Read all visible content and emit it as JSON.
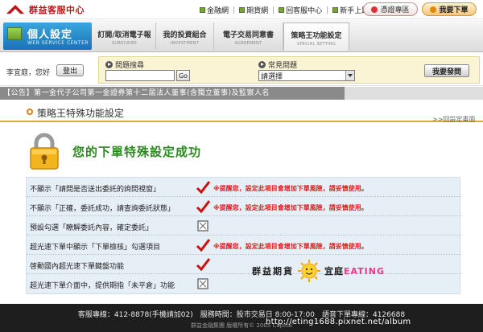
{
  "header": {
    "brand_name": "群益客服中心",
    "top_links": [
      "金融網",
      "期貨網",
      "回客服中心",
      "新手上路"
    ],
    "voice_zone": "憑證專區",
    "order_button": "我要下單"
  },
  "nav": {
    "personal_title": "個人設定",
    "personal_subtitle": "WEB SERVICE CENTER",
    "tabs": [
      {
        "label": "訂閱/取消電子報",
        "sub": "SUBSCRIBE"
      },
      {
        "label": "我的投資組合",
        "sub": "INVESTMENT"
      },
      {
        "label": "電子交易同意書",
        "sub": "AGREEMENT"
      },
      {
        "label": "策略王功能設定",
        "sub": "SPECIAL SETTING"
      }
    ]
  },
  "search": {
    "user_greeting": "李宜庭，您好",
    "logout_label": "登出",
    "question_label": "問題搜尋",
    "question_value": "",
    "go_label": "Go",
    "faq_label": "常見問題",
    "faq_selected": "請選擇",
    "ask_label": "我要發問"
  },
  "announcement": "【公告】第一金代子公司第一金證券第十二屆法人董事(含獨立董事)及監察人名",
  "page": {
    "title": "策略王特殊功能設定",
    "back_link": ">>回設定畫面",
    "success_heading": "您的下單特殊設定成功"
  },
  "settings": [
    {
      "label": "不顯示「請問是否送出委託的詢問視窗」",
      "state": "checked",
      "warning": "※提醒您，設定此項目會增加下單風險，請妥慎使用。"
    },
    {
      "label": "不顯示「正確，委託成功，請查詢委託狀態」",
      "state": "checked",
      "warning": "※提醒您，設定此項目會增加下單風險，請妥慎使用。"
    },
    {
      "label": "預設勾選「瞭解委託內容，確定委託」",
      "state": "unchecked",
      "warning": ""
    },
    {
      "label": "超光速下單中顯示「下單檢核」勾選項目",
      "state": "checked",
      "warning": "※提醒您，設定此項目會增加下單風險，請妥慎使用。"
    },
    {
      "label": "啓動國內超光速下單鍵盤功能",
      "state": "checked",
      "warning": ""
    },
    {
      "label": "超光速下單介面中，提供期指「未平倉」功能",
      "state": "unchecked",
      "warning": ""
    }
  ],
  "brand_stamp": {
    "left_text": "群益期貨",
    "right_text": "宜庭",
    "accent_text": "EATING"
  },
  "footer": {
    "line1": "客服專線：412-8878(手機請加02)　服務時間：股市交易日 8:00-17:00　語音下單專線：4126688",
    "line2": "群益金融集團 版權所有© 2005 Capital"
  },
  "watermark": "http://eting1688.pixnet.net/album",
  "colors": {
    "accent_green": "#2b8a1d",
    "warning_red": "#e11d1d",
    "title_orange": "#e47b13"
  }
}
